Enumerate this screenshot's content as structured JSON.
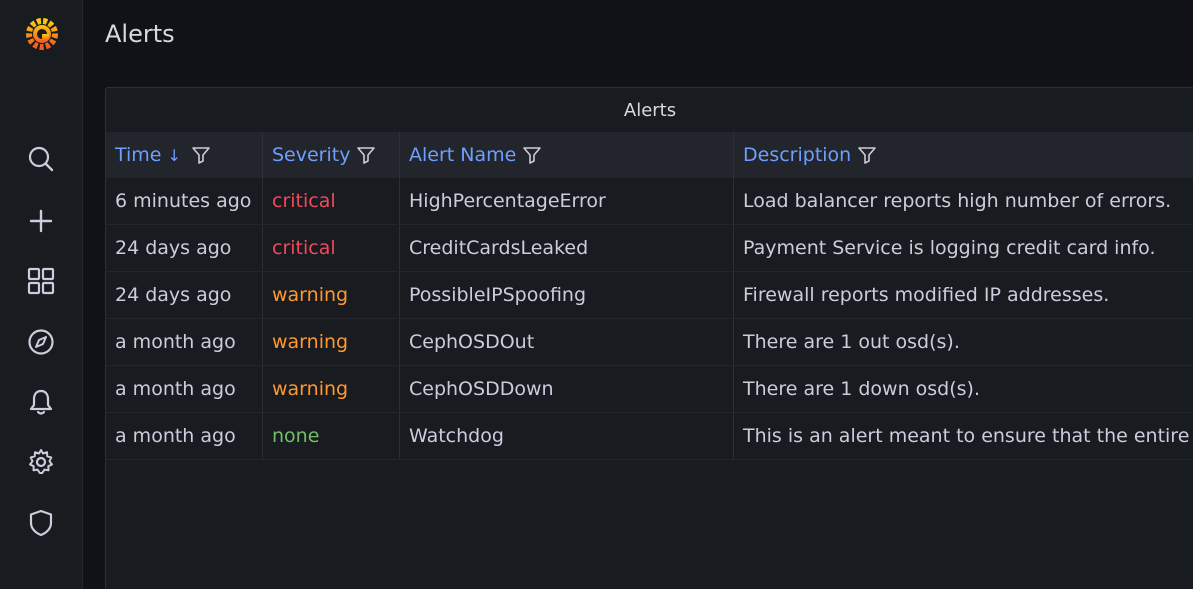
{
  "sidebar": {
    "items": [
      {
        "icon": "search-icon"
      },
      {
        "icon": "plus-icon"
      },
      {
        "icon": "dashboards-icon"
      },
      {
        "icon": "explore-icon"
      },
      {
        "icon": "bell-icon"
      },
      {
        "icon": "gear-icon"
      },
      {
        "icon": "shield-icon"
      }
    ]
  },
  "page": {
    "title": "Alerts"
  },
  "panel": {
    "title": "Alerts",
    "columns": [
      {
        "label": "Time",
        "sort": "↓"
      },
      {
        "label": "Severity"
      },
      {
        "label": "Alert Name"
      },
      {
        "label": "Description"
      }
    ],
    "rows": [
      {
        "time": "6 minutes ago",
        "severity": "critical",
        "name": "HighPercentageError",
        "description": "Load balancer reports high number of errors."
      },
      {
        "time": "24 days ago",
        "severity": "critical",
        "name": "CreditCardsLeaked",
        "description": "Payment Service is logging credit card info."
      },
      {
        "time": "24 days ago",
        "severity": "warning",
        "name": "PossibleIPSpoofing",
        "description": "Firewall reports modified IP addresses."
      },
      {
        "time": "a month ago",
        "severity": "warning",
        "name": "CephOSDOut",
        "description": "There are 1 out osd(s)."
      },
      {
        "time": "a month ago",
        "severity": "warning",
        "name": "CephOSDDown",
        "description": "There are 1 down osd(s)."
      },
      {
        "time": "a month ago",
        "severity": "none",
        "name": "Watchdog",
        "description": "This is an alert meant to ensure that the entire alerting pipeline is functional."
      }
    ]
  },
  "colors": {
    "critical": "#f2495c",
    "warning": "#ff9830",
    "none": "#73bf69",
    "header_link": "#6e9fff"
  }
}
